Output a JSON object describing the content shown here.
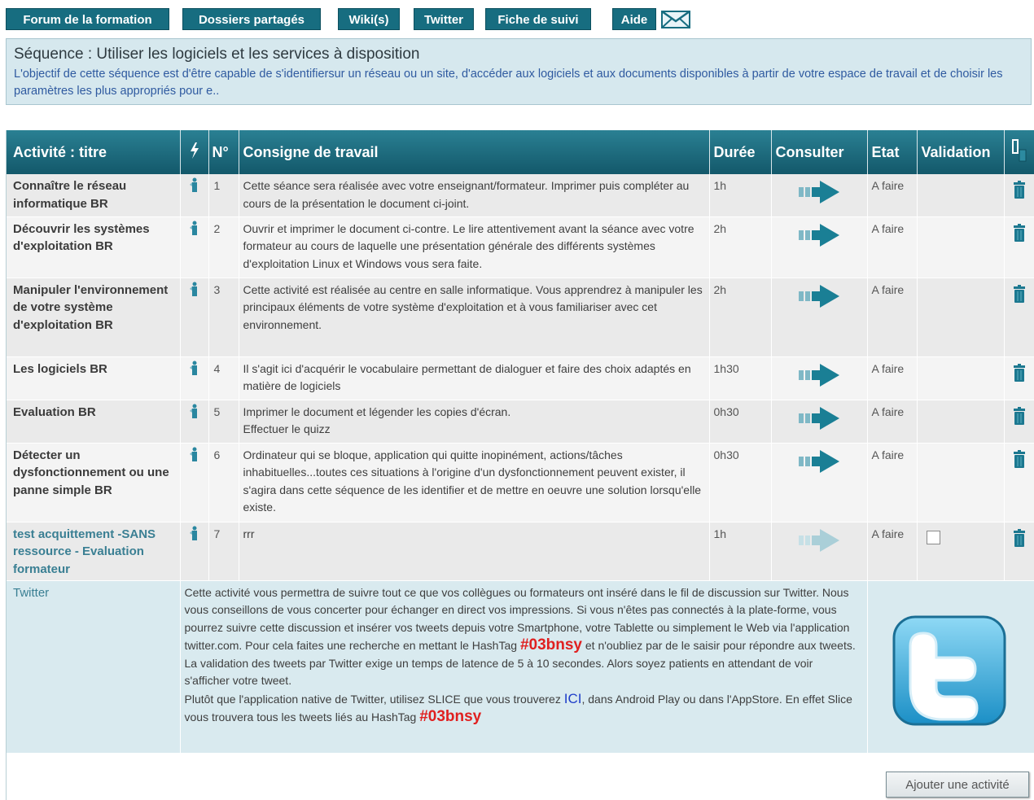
{
  "nav": {
    "items": [
      {
        "label": "Forum de la formation"
      },
      {
        "label": "Dossiers partagés"
      },
      {
        "label": "Wiki(s)"
      },
      {
        "label": "Twitter"
      },
      {
        "label": "Fiche de suivi"
      },
      {
        "label": "Aide"
      }
    ],
    "mail_icon": "envelope-icon"
  },
  "sequence": {
    "title": "Séquence : Utiliser les logiciels et les services à disposition",
    "description": "L'objectif de cette séquence est d'être capable de s'identifiersur un réseau ou un site, d'accéder aux logiciels et aux documents disponibles à partir de votre espace de travail et de choisir les paramètres les plus appropriés pour e.."
  },
  "table": {
    "headers": {
      "title": "Activité : titre",
      "num": "N°",
      "consigne": "Consigne de travail",
      "duree": "Durée",
      "consulter": "Consulter",
      "etat": "Etat",
      "validation": "Validation"
    },
    "rows": [
      {
        "title": "Connaître le réseau informatique BR",
        "num": "1",
        "consigne": "Cette séance sera réalisée avec votre enseignant/formateur. Imprimer puis compléter au cours de la présentation le document ci-joint.",
        "duree": "1h",
        "etat": "A faire"
      },
      {
        "title": "Découvrir les systèmes d'exploitation BR",
        "num": "2",
        "consigne": "Ouvrir et imprimer le document ci-contre. Le lire attentivement avant la séance avec votre formateur au cours de laquelle une présentation générale des différents systèmes d'exploitation Linux et Windows vous sera faite.",
        "duree": "2h",
        "etat": "A faire"
      },
      {
        "title": "Manipuler l'environnement de votre système d'exploitation BR",
        "num": "3",
        "consigne": "Cette activité est réalisée au centre en salle informatique. Vous apprendrez à manipuler les principaux éléments de votre système d'exploitation et à vous familiariser avec cet environnement.",
        "duree": "2h",
        "etat": "A faire"
      },
      {
        "title": "Les logiciels BR",
        "num": "4",
        "consigne": "Il s'agit ici d'acquérir le vocabulaire permettant de dialoguer et faire des choix adaptés en matière de logiciels",
        "duree": "1h30",
        "etat": "A faire"
      },
      {
        "title": "Evaluation BR",
        "num": "5",
        "consigne": "Imprimer le document et légender les copies d'écran.\nEffectuer le quizz",
        "duree": "0h30",
        "etat": "A faire"
      },
      {
        "title": "Détecter un dysfonctionnement ou une panne simple BR",
        "num": "6",
        "consigne": "Ordinateur qui se bloque, application qui quitte inopinément, actions/tâches inhabituelles...toutes ces situations à l'origine d'un dysfonctionnement peuvent exister, il s'agira dans cette séquence de les identifier et de mettre en oeuvre une solution lorsqu'elle existe.",
        "duree": "0h30",
        "etat": "A faire"
      },
      {
        "title": "test acquittement -SANS ressource - Evaluation formateur",
        "num": "7",
        "consigne": "rrr",
        "duree": "1h",
        "etat": "A faire"
      }
    ],
    "twitter": {
      "title": "Twitter",
      "text1": "Cette activité vous permettra de suivre tout ce que vos collègues ou formateurs ont inséré dans le fil de discussion sur Twitter. Nous vous conseillons de vous concerter pour échanger en direct vos impressions. Si vous n'êtes pas connectés à la plate-forme, vous pourrez suivre cette discussion et insérer vos tweets depuis votre Smartphone, votre Tablette ou simplement le Web via l'application twitter.com. Pour cela faites une recherche en mettant le HashTag ",
      "hashtag": "#03bnsy",
      "text2": " et n'oubliez par de le saisir pour répondre aux tweets. La validation des tweets par Twitter exige un temps de latence de 5 à 10 secondes. Alors soyez patients en attendant de voir s'afficher votre tweet.",
      "text3": "Plutôt que l'application native de Twitter, utilisez SLICE que vous trouverez ",
      "ici": "ICI",
      "text4": ", dans Android Play ou dans l'AppStore. En effet Slice vous trouvera tous les tweets liés au HashTag ",
      "hashtag2": "#03bnsy"
    }
  },
  "add_button": "Ajouter une activité",
  "colors": {
    "nav_bg": "#176d80",
    "header_bg": "#1a6b7e",
    "seq_bg": "#d6e8ee",
    "arrow": "#1a7f95",
    "hashtag": "#e02020"
  }
}
